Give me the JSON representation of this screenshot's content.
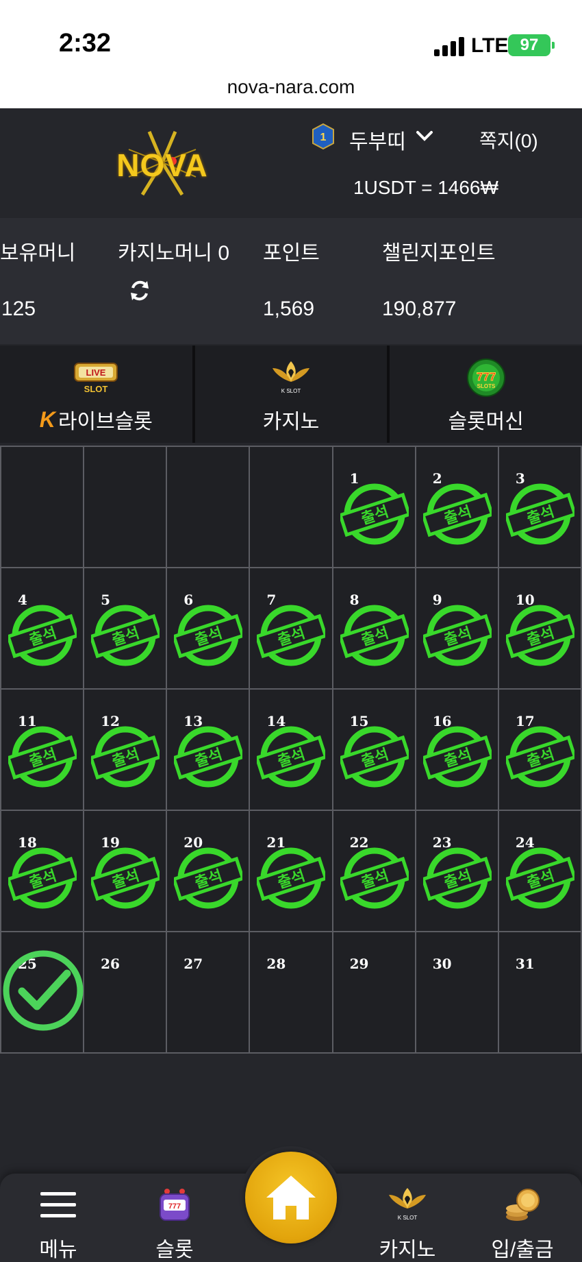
{
  "status_bar": {
    "time": "2:32",
    "network": "LTE",
    "battery": "97"
  },
  "browser": {
    "url": "nova-nara.com"
  },
  "header": {
    "logo_text": "NOVA",
    "rank_level": "1",
    "username": "두부띠",
    "messages": "쪽지(0)",
    "exchange_rate": "1USDT = 1466₩"
  },
  "balances": {
    "holding": {
      "label": "보유머니",
      "value": "125"
    },
    "casino": {
      "label": "카지노머니 0"
    },
    "points": {
      "label": "포인트",
      "value": "1,569"
    },
    "challenge": {
      "label": "챌린지포인트",
      "value": "190,877"
    }
  },
  "tabs": [
    {
      "label": "라이브슬롯",
      "icon": "live-slot-icon",
      "icon_text": "LIVE SLOT"
    },
    {
      "label": "카지노",
      "icon": "kslot-lotus-icon",
      "icon_text": "K SLOT"
    },
    {
      "label": "슬롯머신",
      "icon": "777-slots-icon",
      "icon_text": "777"
    }
  ],
  "calendar": {
    "stamp_text": "출석",
    "leading_blanks": 4,
    "days": [
      "1",
      "2",
      "3",
      "4",
      "5",
      "6",
      "7",
      "8",
      "9",
      "10",
      "11",
      "12",
      "13",
      "14",
      "15",
      "16",
      "17",
      "18",
      "19",
      "20",
      "21",
      "22",
      "23",
      "24",
      "25",
      "26",
      "27",
      "28",
      "29",
      "30",
      "31"
    ],
    "attended_through": 24,
    "today": 25,
    "colors": {
      "stamp": "#39d82b",
      "check": "#4cd35a"
    }
  },
  "bottom_nav": {
    "menu": "메뉴",
    "slot": "슬롯",
    "casino": "카지노",
    "deposit": "입/출금",
    "kslot_text": "K SLOT"
  }
}
